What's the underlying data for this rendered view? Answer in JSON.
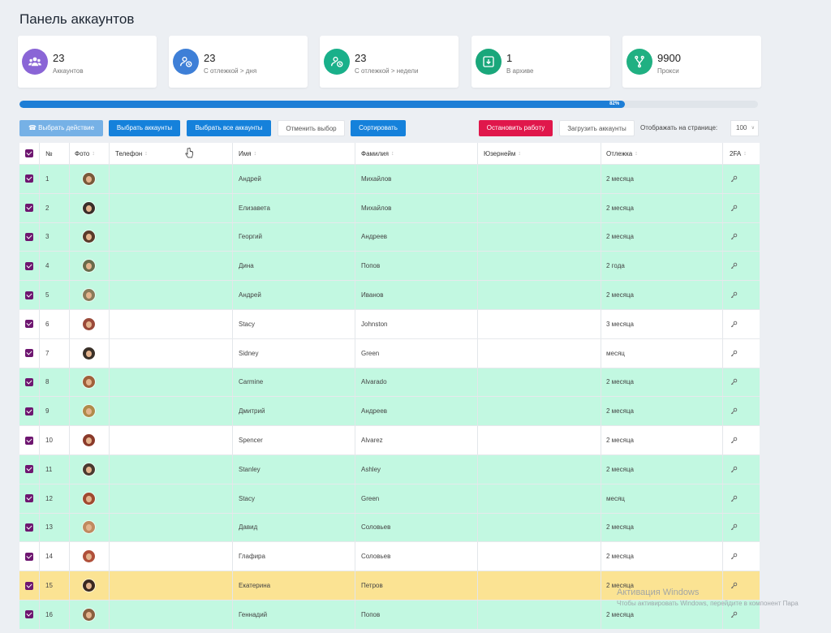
{
  "page": {
    "title": "Панель аккаунтов"
  },
  "stats": [
    {
      "value": "23",
      "label": "Аккаунтов",
      "icon": "users-icon",
      "color": "#8a65d6"
    },
    {
      "value": "23",
      "label": "С отлежкой > дня",
      "icon": "user-clock-icon",
      "color": "#3e7fd7"
    },
    {
      "value": "23",
      "label": "С отлежкой > недели",
      "icon": "user-clock-icon",
      "color": "#19b08a"
    },
    {
      "value": "1",
      "label": "В архиве",
      "icon": "archive-icon",
      "color": "#1aa77b"
    },
    {
      "value": "9900",
      "label": "Прокси",
      "icon": "fork-icon",
      "color": "#20b082"
    }
  ],
  "progress": {
    "value": 82,
    "label": "82%"
  },
  "toolbar": {
    "choose_action": "Выбрать действие",
    "select_accounts": "Выбрать аккаунты",
    "select_all": "Выбрать все аккаунты",
    "cancel_selection": "Отменить выбор",
    "sort": "Сортировать",
    "stop": "Остановить работу",
    "load_accounts": "Загрузить аккаунты",
    "per_page_label": "Отображать на странице:",
    "per_page_value": "100"
  },
  "table": {
    "columns": [
      "№",
      "Фото",
      "Телефон",
      "Имя",
      "Фамилия",
      "Юзернейм",
      "Отлежка",
      "2FA"
    ],
    "rows": [
      {
        "num": "1",
        "phone": "",
        "first": "Андрей",
        "last": "Михайлов",
        "username": "",
        "age": "2 месяца",
        "status": "green",
        "avatar": "#7a5a3a"
      },
      {
        "num": "2",
        "phone": "",
        "first": "Елизавета",
        "last": "Михайлов",
        "username": "",
        "age": "2 месяца",
        "status": "green",
        "avatar": "#3a2f2a"
      },
      {
        "num": "3",
        "phone": "",
        "first": "Георгий",
        "last": "Андреев",
        "username": "",
        "age": "2 месяца",
        "status": "green",
        "avatar": "#5a3a2a"
      },
      {
        "num": "4",
        "phone": "",
        "first": "Дина",
        "last": "Попов",
        "username": "",
        "age": "2 года",
        "status": "green",
        "avatar": "#6a6a4a"
      },
      {
        "num": "5",
        "phone": "",
        "first": "Андрей",
        "last": "Иванов",
        "username": "",
        "age": "2 месяца",
        "status": "green",
        "avatar": "#8a7a5a"
      },
      {
        "num": "6",
        "phone": "",
        "first": "Stacy",
        "last": "Johnston",
        "username": "",
        "age": "3 месяца",
        "status": "white",
        "avatar": "#9a4a3a"
      },
      {
        "num": "7",
        "phone": "",
        "first": "Sidney",
        "last": "Green",
        "username": "",
        "age": "месяц",
        "status": "white",
        "avatar": "#3a3028"
      },
      {
        "num": "8",
        "phone": "",
        "first": "Carmine",
        "last": "Alvarado",
        "username": "",
        "age": "2 месяца",
        "status": "green",
        "avatar": "#a0603a"
      },
      {
        "num": "9",
        "phone": "",
        "first": "Дмитрий",
        "last": "Андреев",
        "username": "",
        "age": "2 месяца",
        "status": "green",
        "avatar": "#b08a4a"
      },
      {
        "num": "10",
        "phone": "",
        "first": "Spencer",
        "last": "Alvarez",
        "username": "",
        "age": "2 месяца",
        "status": "white",
        "avatar": "#8a3a2a"
      },
      {
        "num": "11",
        "phone": "",
        "first": "Stanley",
        "last": "Ashley",
        "username": "",
        "age": "2 месяца",
        "status": "green",
        "avatar": "#4a3a30"
      },
      {
        "num": "12",
        "phone": "",
        "first": "Stacy",
        "last": "Green",
        "username": "",
        "age": "месяц",
        "status": "green",
        "avatar": "#a04a30"
      },
      {
        "num": "13",
        "phone": "",
        "first": "Давид",
        "last": "Соловьев",
        "username": "",
        "age": "2 месяца",
        "status": "green",
        "avatar": "#c08a60"
      },
      {
        "num": "14",
        "phone": "",
        "first": "Глафира",
        "last": "Соловьев",
        "username": "",
        "age": "2 месяца",
        "status": "white",
        "avatar": "#b0503a"
      },
      {
        "num": "15",
        "phone": "",
        "first": "Екатерина",
        "last": "Петров",
        "username": "",
        "age": "2 месяца",
        "status": "yellow",
        "avatar": "#3a2820"
      },
      {
        "num": "16",
        "phone": "",
        "first": "Геннадий",
        "last": "Попов",
        "username": "",
        "age": "2 месяца",
        "status": "green",
        "avatar": "#8a6040"
      }
    ]
  },
  "watermark": {
    "line1": "Активация Windows",
    "line2": "Чтобы активировать Windows, перейдите в компонент Пара"
  }
}
